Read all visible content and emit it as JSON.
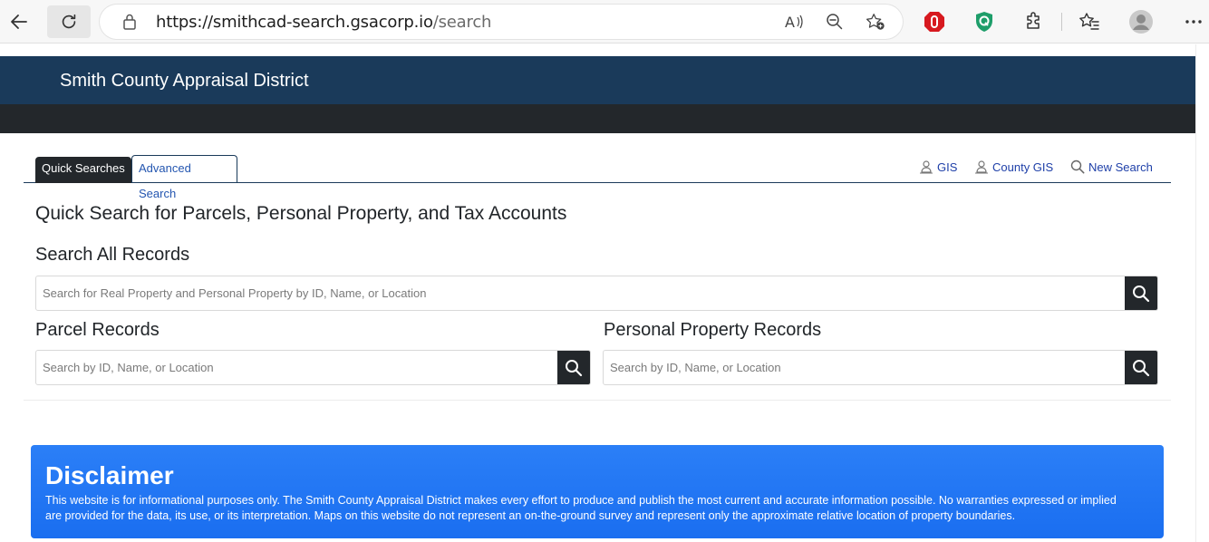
{
  "browser": {
    "url_host": "https://smithcad-search.gsacorp.io",
    "url_path": "/search"
  },
  "site": {
    "title": "Smith County Appraisal District"
  },
  "tabs": [
    {
      "label": "Quick Searches",
      "active": true
    },
    {
      "label": "Advanced Search",
      "active": false
    }
  ],
  "top_links": [
    {
      "label": "GIS",
      "icon": "person-pin-icon"
    },
    {
      "label": "County GIS",
      "icon": "person-pin-icon"
    },
    {
      "label": "New Search",
      "icon": "search-icon"
    }
  ],
  "main": {
    "heading": "Quick Search for Parcels, Personal Property, and Tax Accounts",
    "all_records": {
      "title": "Search All Records",
      "placeholder": "Search for Real Property and Personal Property by ID, Name, or Location"
    },
    "parcel_records": {
      "title": "Parcel Records",
      "placeholder": "Search by ID, Name, or Location"
    },
    "personal_property": {
      "title": "Personal Property Records",
      "placeholder": "Search by ID, Name, or Location"
    }
  },
  "disclaimer": {
    "title": "Disclaimer",
    "text": "This website is for informational purposes only. The Smith County Appraisal District makes every effort to produce and publish the most current and accurate information possible. No warranties expressed or implied are provided for the data, its use, or its interpretation. Maps on this website do not represent an on-the-ground survey and represent only the approximate relative location of property boundaries."
  },
  "colors": {
    "header_blue": "#1a3a5a",
    "header_dark": "#23272b",
    "link_blue": "#1e3fa8",
    "disclaimer_blue": "#2379f5"
  }
}
